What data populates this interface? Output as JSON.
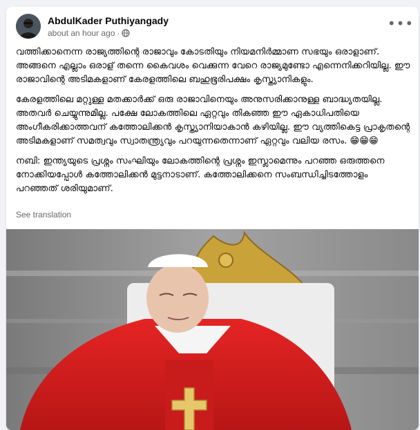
{
  "post": {
    "author": "AbdulKader Puthiyangady",
    "timestamp": "about an hour ago",
    "separator": "·",
    "privacy_icon": "globe-icon",
    "more_icon": "more-options-icon",
    "paragraphs": [
      "വത്തിക്കാനെന്ന രാജ്യത്തിന്റെ രാജാവും കോടതിയും നിയമനിർമ്മാണ സഭയും ഒരാളാണ്. അങ്ങനെ എല്ലാം ഒരാള് തന്നെ കൈവശം വെക്കുന്ന വേറെ രാജ്യമുണ്ടോ എന്നെനിക്കറിയില്ല. ഈ രാജാവിന്റെ അടിമകളാണ് കേരളത്തിലെ ബഹുഭൂരിപക്ഷം കൃസ്ത്യാനികളും.",
      "കേരളത്തിലെ മറ്റുള്ള മതക്കാർക്ക് ഒരു രാജാവിനെയും അനുസരിക്കാനുള്ള ബാദ്ധ്യതയില്ല. അതവർ ചെയ്യുന്നുമില്ല. പക്ഷേ ലോകത്തിലെ ഏറ്റവും തികഞ്ഞ ഈ ഏകാധിപതിയെ അംഗീകരിക്കാത്തവന് കത്തോലിക്കൻ കൃസ്ത്യാനിയാകാൻ കഴിയില്ല. ഈ വ്യത്തികെട്ട പ്രാകൃതന്റെ അടിമകളാണ് സമത്വവും സ്വാതന്ത്ര്യവും പറയുന്നതെന്നാണ് ഏറ്റവും വലിയ രസം. 😁😁😁",
      "നബി: ഇന്ത്യയുടെ പ്രശ്നം സംഘിയും ലോകത്തിന്റെ പ്രശ്നം ഇസ്ലാമെന്നും പറഞ്ഞ ഒരുത്തനെ നോക്കിയപ്പോൾ കത്തോലിക്കൻ മുട്ടനാടാണ്. കത്തോലിക്കനെ സംബന്ധിച്ചിടത്തോളം പറഞ്ഞത് ശരിയുമാണ്."
    ],
    "see_translation": "See translation"
  },
  "colors": {
    "background": "#f0f2f5",
    "card": "#ffffff",
    "text_primary": "#050505",
    "text_secondary": "#65676b",
    "vestment_red": "#d81e1e",
    "throne_gold": "#c9a23a"
  }
}
